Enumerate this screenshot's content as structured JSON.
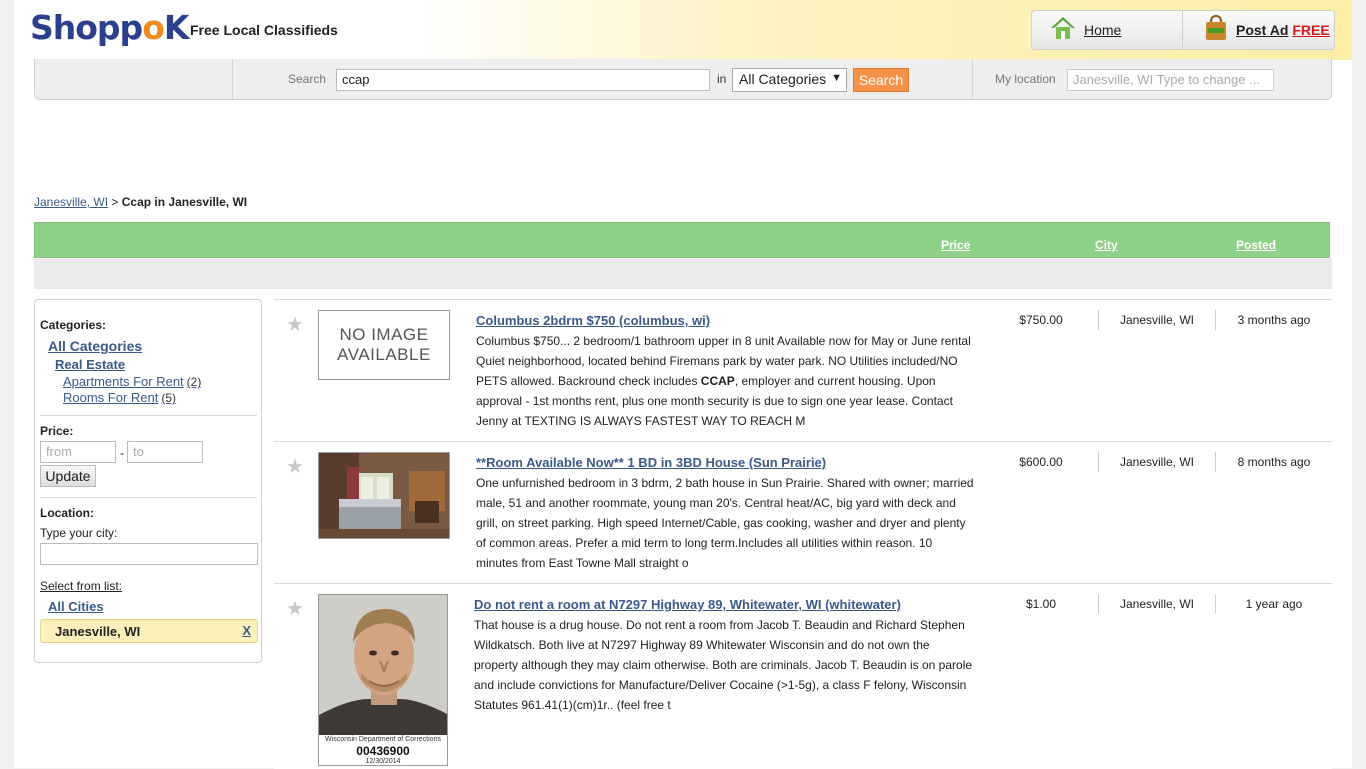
{
  "header": {
    "logo_text": "ShoppoK",
    "tagline": "Free Local Classifieds",
    "home_label": "Home",
    "post_ad_label": "Post Ad",
    "post_ad_free": "FREE"
  },
  "search": {
    "label": "Search",
    "value": "ccap",
    "in_label": "in",
    "category_selected": "All Categories",
    "button_label": "Search",
    "location_label": "My location",
    "location_placeholder": "Janesville, WI  Type to change ..."
  },
  "breadcrumb": {
    "link": "Janesville, WI",
    "separator": ">",
    "current": "Ccap in Janesville, WI"
  },
  "columns": {
    "price": "Price",
    "city": "City",
    "posted": "Posted"
  },
  "sidebar": {
    "categories_title": "Categories:",
    "all_categories": "All Categories",
    "real_estate": "Real Estate",
    "subcategories": [
      {
        "label": "Apartments For Rent",
        "count": "(2)"
      },
      {
        "label": "Rooms For Rent",
        "count": "(5)"
      }
    ],
    "price_title": "Price:",
    "price_from_placeholder": "from",
    "price_dash": "-",
    "price_to_placeholder": "to",
    "update_label": "Update",
    "location_title": "Location:",
    "type_city_label": "Type your city:",
    "select_from_list": "Select from list:",
    "all_cities": "All Cities",
    "selected_city": "Janesville, WI",
    "remove_label": "X"
  },
  "listings": [
    {
      "title": "Columbus 2bdrm $750 (columbus, wi)",
      "desc_before": "Columbus $750... 2 bedroom/1 bathroom upper in 8 unit Available now for May or June rental Quiet neighborhood, located behind Firemans park by water park. NO Utilities included/NO PETS allowed. Backround check includes ",
      "desc_bold": "CCAP",
      "desc_after": ", employer and current housing. Upon approval - 1st months rent, plus one month security is due to sign one year lease. Contact Jenny at TEXTING IS ALWAYS FASTEST WAY TO REACH M",
      "image_line1": "NO IMAGE",
      "image_line2": "AVAILABLE",
      "price": "$750.00",
      "city": "Janesville, WI",
      "posted": "3 months ago"
    },
    {
      "title": "**Room Available Now** 1 BD in 3BD House (Sun Prairie)",
      "desc_before": "One unfurnished bedroom in 3 bdrm, 2 bath house in Sun Prairie. Shared with owner; married male, 51 and another roommate, young man 20's. Central heat/AC, big yard with deck and grill, on street parking. High speed Internet/Cable, gas cooking, washer and dryer and plenty of common areas. Prefer a mid term to long term.Includes all utilities within reason. 10 minutes from East Towne Mall straight o",
      "desc_bold": "",
      "desc_after": "",
      "price": "$600.00",
      "city": "Janesville, WI",
      "posted": "8 months ago"
    },
    {
      "title": "Do not rent a room at N7297 Highway 89, Whitewater, WI (whitewater)",
      "desc_before": "That house is a drug house. Do not rent a room from Jacob T. Beaudin and Richard Stephen Wildkatsch. Both live at N7297 Highway 89 Whitewater Wisconsin and do not own the property although they may claim otherwise. Both are criminals. Jacob T. Beaudin is on parole and include convictions for Manufacture/Deliver Cocaine (>1-5g), a class F felony, Wisconsin Statutes 961.41(1)(cm)1r.. (feel free t",
      "desc_bold": "",
      "desc_after": "",
      "photo_caption": "Wisconsin Department of Corrections",
      "photo_number": "00436900",
      "photo_date": "12/30/2014",
      "price": "$1.00",
      "city": "Janesville, WI",
      "posted": "1 year ago"
    }
  ],
  "colors": {
    "accent_green": "#90d18a",
    "link_blue": "#3a5a8c",
    "search_orange": "#f7924a",
    "logo_blue": "#2b3f8c",
    "logo_orange": "#f08a1c"
  }
}
